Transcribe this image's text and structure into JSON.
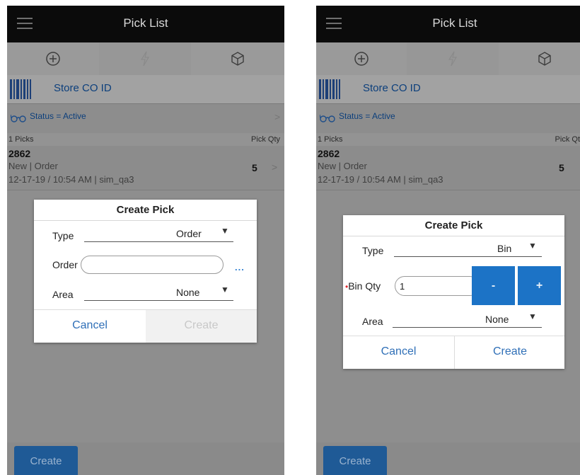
{
  "colors": {
    "accent": "#1f5a96",
    "link": "#2f6fb7",
    "step_button": "#1c73c6",
    "required": "#e0252b"
  },
  "screens": [
    {
      "header": {
        "title": "Pick List"
      },
      "toolbar": {
        "icons": [
          "plus-circle-icon",
          "lightning-icon",
          "cube-icon"
        ]
      },
      "scan": {
        "label": "Store CO ID"
      },
      "filter": {
        "text": "Status = Active"
      },
      "list": {
        "count_label": "1 Picks",
        "qty_header": "Pick Qty",
        "items": [
          {
            "id": "2862",
            "status_type": "New  |  Order",
            "datetime_user": "12-17-19 / 10:54 AM  |  sim_qa3",
            "qty": "5"
          }
        ]
      },
      "dialog": {
        "title": "Create Pick",
        "type_label": "Type",
        "type_value": "Order",
        "order_label": "Order",
        "order_value": "",
        "more": "...",
        "area_label": "Area",
        "area_value": "None",
        "cancel": "Cancel",
        "create": "Create"
      },
      "bottom": {
        "create": "Create"
      }
    },
    {
      "header": {
        "title": "Pick List"
      },
      "toolbar": {
        "icons": [
          "plus-circle-icon",
          "lightning-icon",
          "cube-icon"
        ]
      },
      "scan": {
        "label": "Store CO ID"
      },
      "filter": {
        "text": "Status = Active"
      },
      "list": {
        "count_label": "1 Picks",
        "qty_header": "Pick Qt",
        "items": [
          {
            "id": "2862",
            "status_type": "New  |  Order",
            "datetime_user": "12-17-19 / 10:54 AM  |  sim_qa3",
            "qty": "5"
          }
        ]
      },
      "dialog": {
        "title": "Create Pick",
        "type_label": "Type",
        "type_value": "Bin",
        "required_mark": "•",
        "binqty_label": "Bin Qty",
        "binqty_value": "1",
        "minus": "-",
        "plus": "+",
        "area_label": "Area",
        "area_value": "None",
        "cancel": "Cancel",
        "create": "Create"
      },
      "bottom": {
        "create": "Create"
      }
    }
  ]
}
